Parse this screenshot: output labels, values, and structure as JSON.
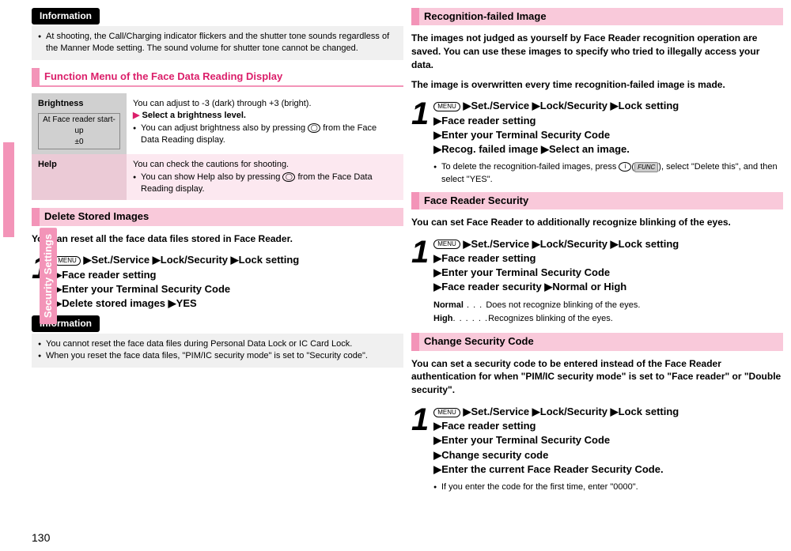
{
  "page_number": "130",
  "side_label": "Security Settings",
  "left": {
    "info_label": "Information",
    "info1_text": "At shooting, the Call/Charging indicator flickers and the shutter tone sounds regardless of the Manner Mode setting. The sound volume for shutter tone cannot be changed.",
    "section_func": "Function Menu of the Face Data Reading Display",
    "table": {
      "r1c1_title": "Brightness",
      "r1c1_sub1": "At Face reader start-up",
      "r1c1_sub2": "±0",
      "r1c2_line1": "You can adjust to -3 (dark) through +3 (bright).",
      "r1c2_line2a": "▶",
      "r1c2_line2b": "Select a brightness level.",
      "r1c2_line3": "You can adjust brightness also by pressing ",
      "r1c2_line3_key": "◯",
      "r1c2_line3_b": " from the Face Data Reading display.",
      "r2c1": "Help",
      "r2c2_line1": "You can check the cautions for shooting.",
      "r2c2_line2": "You can show Help also by pressing ",
      "r2c2_key": "◯",
      "r2c2_line2b": " from the Face Data Reading display."
    },
    "section_delete": "Delete Stored Images",
    "delete_intro": "You can reset all the face data files stored in Face Reader.",
    "delete_step": {
      "icon": "MENU",
      "p1": "Set./Service",
      "p2": "Lock/Security",
      "p3": "Lock setting",
      "p4": "Face reader setting",
      "p5": "Enter your Terminal Security Code",
      "p6": "Delete stored images",
      "p7": "YES"
    },
    "info2_line1": "You cannot reset the face data files during Personal Data Lock or IC Card Lock.",
    "info2_line2": "When you reset the face data files, \"PIM/IC security mode\" is set to \"Security code\"."
  },
  "right": {
    "section_recog": "Recognition-failed Image",
    "recog_intro1": "The images not judged as yourself by Face Reader recognition operation are saved. You can use these images to specify who tried to illegally access your data.",
    "recog_intro2": "The image is overwritten every time recognition-failed image is made.",
    "recog_step": {
      "icon": "MENU",
      "p1": "Set./Service",
      "p2": "Lock/Security",
      "p3": "Lock setting",
      "p4": "Face reader setting",
      "p5": "Enter your Terminal Security Code",
      "p6": "Recog. failed image",
      "p7": "Select an image."
    },
    "recog_note_a": "To delete the recognition-failed images, press ",
    "recog_note_key": "i",
    "recog_note_func": "FUNC",
    "recog_note_b": ", select \"Delete this\", and then select \"YES\".",
    "section_face_sec": "Face Reader Security",
    "face_sec_intro": "You can set Face Reader to additionally recognize blinking of the eyes.",
    "face_sec_step": {
      "icon": "MENU",
      "p1": "Set./Service",
      "p2": "Lock/Security",
      "p3": "Lock setting",
      "p4": "Face reader setting",
      "p5": "Enter your Terminal Security Code",
      "p6": "Face reader security",
      "p7": "Normal or High"
    },
    "def_normal_label": "Normal",
    "def_normal_dots": " . . . ",
    "def_normal_text": "Does not recognize blinking of the eyes.",
    "def_high_label": "High",
    "def_high_dots": ". . . . . .",
    "def_high_text": "Recognizes blinking of the eyes.",
    "section_change": "Change Security Code",
    "change_intro": "You can set a security code to be entered instead of the Face Reader authentication for when \"PIM/IC security mode\" is set to \"Face reader\" or \"Double security\".",
    "change_step": {
      "icon": "MENU",
      "p1": "Set./Service",
      "p2": "Lock/Security",
      "p3": "Lock setting",
      "p4": "Face reader setting",
      "p5": "Enter your Terminal Security Code",
      "p6": "Change security code",
      "p7": "Enter the current Face Reader Security Code."
    },
    "change_note": "If you enter the code for the first time, enter \"0000\"."
  }
}
